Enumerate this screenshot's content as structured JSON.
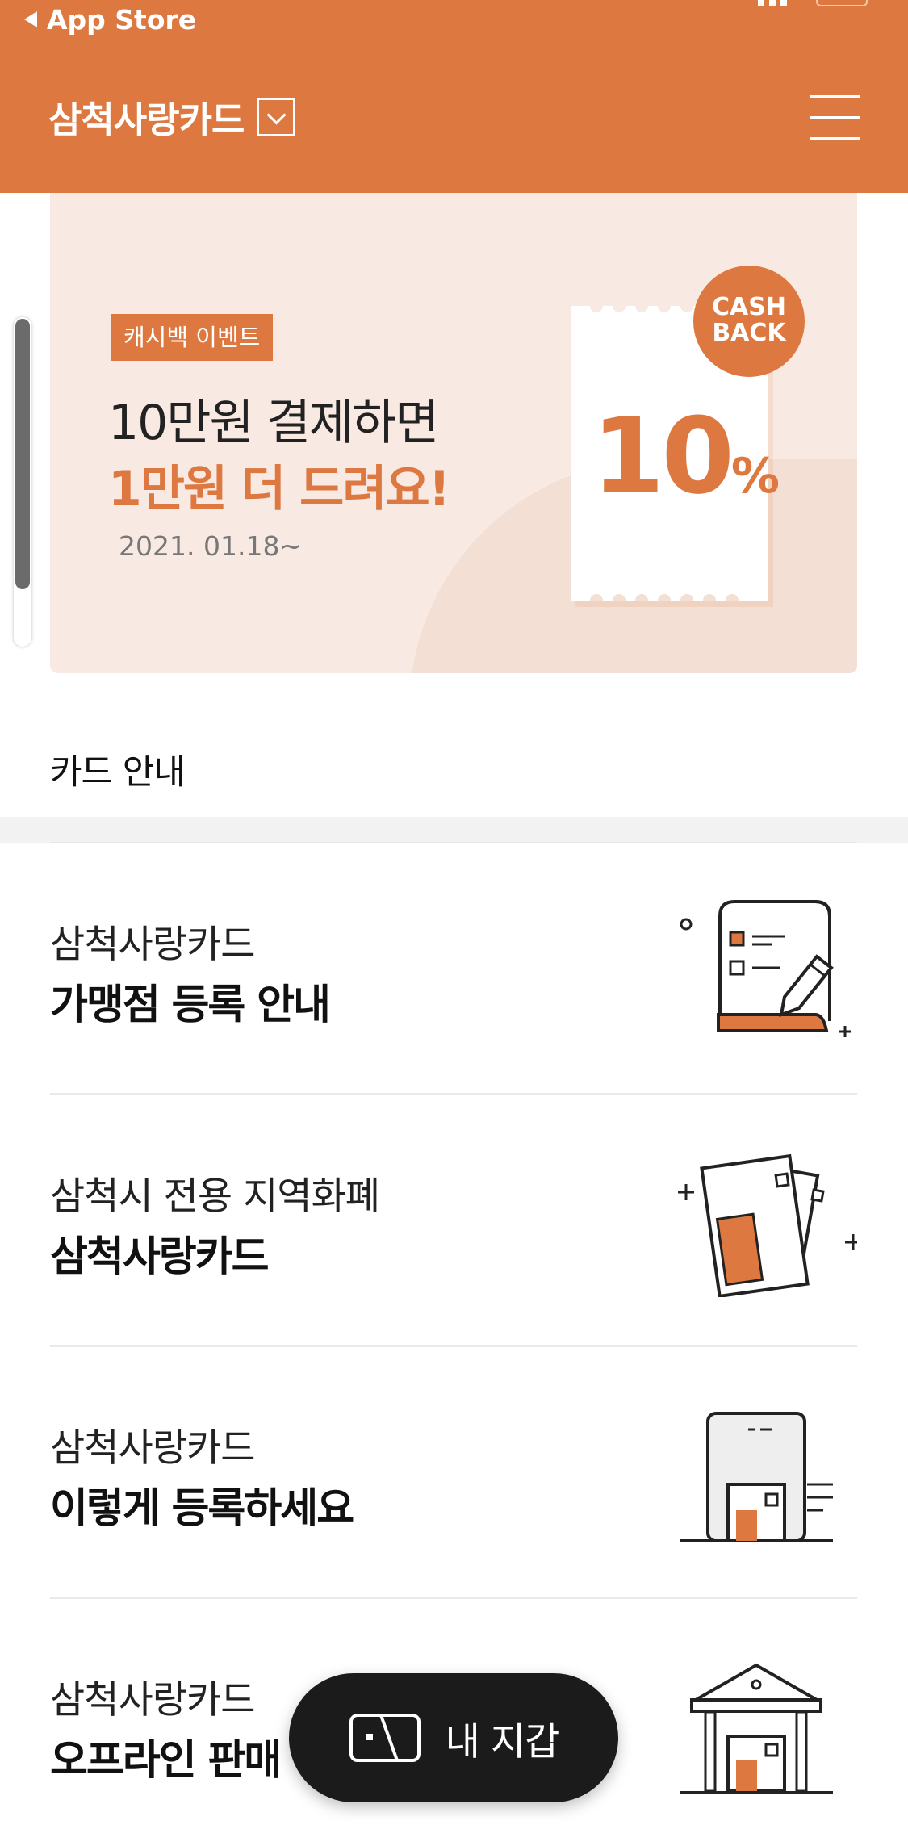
{
  "status_bar": {
    "back_label": "App Store"
  },
  "header": {
    "title": "삼척사랑카드",
    "dropdown_icon": "chevron-down-icon",
    "menu_icon": "hamburger-menu-icon"
  },
  "banner": {
    "badge": "캐시백 이벤트",
    "line1": "10만원 결제하면",
    "line2": "1만원 더 드려요!",
    "date": "2021. 01.18~",
    "receipt_number": "10",
    "receipt_unit": "%",
    "cashback_line1": "CASH",
    "cashback_line2": "BACK"
  },
  "section": {
    "title": "카드 안내"
  },
  "guide_items": [
    {
      "sub": "삼척사랑카드",
      "main": "가맹점 등록 안내",
      "icon": "document-pencil-icon"
    },
    {
      "sub": "삼척시 전용 지역화폐",
      "main": "삼척사랑카드",
      "icon": "cards-icon"
    },
    {
      "sub": "삼척사랑카드",
      "main": "이렇게 등록하세요",
      "icon": "phone-card-icon"
    },
    {
      "sub": "삼척사랑카드",
      "main": "오프라인 판매",
      "icon": "bank-building-icon"
    }
  ],
  "wallet_button": {
    "label": "내 지갑",
    "icon": "wallet-icon"
  },
  "colors": {
    "accent": "#DD7840",
    "banner_bg": "#F8EAE2",
    "dark": "#1B1B1B"
  }
}
